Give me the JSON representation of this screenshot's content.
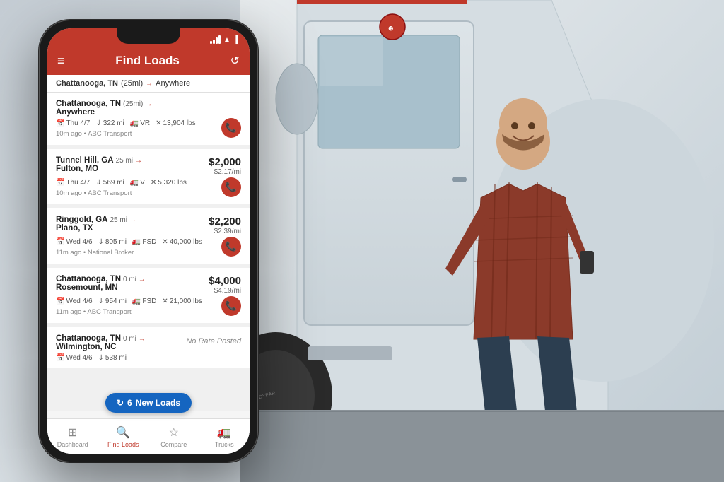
{
  "background": {
    "gradient_desc": "truck and person background scene"
  },
  "phone": {
    "header": {
      "title": "Find Loads",
      "menu_icon": "≡",
      "refresh_icon": "↺"
    },
    "route_bar": {
      "origin": "Chattanooga, TN",
      "origin_dist": "(25mi)",
      "arrow": "→",
      "destination": "Anywhere"
    },
    "loads": [
      {
        "id": 1,
        "origin": "Chattanooga, TN",
        "origin_dist": "(25mi)",
        "destination": "Anywhere",
        "price": "",
        "price_per_mile": "",
        "no_rate": true,
        "date": "Thu 4/7",
        "miles": "322 mi",
        "truck_type": "VR",
        "weight": "13,904 lbs",
        "time_ago": "10m ago",
        "broker": "ABC Transport"
      },
      {
        "id": 2,
        "origin": "Tunnel Hill, GA",
        "origin_dist": "25 mi",
        "destination": "Fulton, MO",
        "price": "$2,000",
        "price_per_mile": "$2.17/mi",
        "no_rate": false,
        "date": "Thu 4/7",
        "miles": "569 mi",
        "truck_type": "V",
        "weight": "5,320 lbs",
        "time_ago": "10m ago",
        "broker": "ABC Transport"
      },
      {
        "id": 3,
        "origin": "Ringgold, GA",
        "origin_dist": "25 mi",
        "destination": "Plano, TX",
        "price": "$2,200",
        "price_per_mile": "$2.39/mi",
        "no_rate": false,
        "date": "Wed 4/6",
        "miles": "805 mi",
        "truck_type": "FSD",
        "weight": "40,000 lbs",
        "time_ago": "11m ago",
        "broker": "National Broker"
      },
      {
        "id": 4,
        "origin": "Chattanooga, TN",
        "origin_dist": "0 mi",
        "destination": "Rosemount, MN",
        "price": "$4,000",
        "price_per_mile": "$4.19/mi",
        "no_rate": false,
        "date": "Wed 4/6",
        "miles": "954 mi",
        "truck_type": "FSD",
        "weight": "21,000 lbs",
        "time_ago": "11m ago",
        "broker": "ABC Transport"
      },
      {
        "id": 5,
        "origin": "Chattanooga, TN",
        "origin_dist": "0 mi",
        "destination": "Wilmington, NC",
        "price": "",
        "price_per_mile": "",
        "no_rate": true,
        "no_rate_text": "No Rate Posted",
        "date": "Wed 4/6",
        "miles": "538 mi",
        "truck_type": "",
        "weight": "",
        "time_ago": "",
        "broker": ""
      }
    ],
    "new_loads_btn": {
      "count": 6,
      "label": "New Loads",
      "icon": "↻"
    },
    "bottom_nav": [
      {
        "label": "Dashboard",
        "icon": "⊞",
        "active": false
      },
      {
        "label": "Find Loads",
        "icon": "🔍",
        "active": true
      },
      {
        "label": "Compare",
        "icon": "☆",
        "active": false
      },
      {
        "label": "Trucks",
        "icon": "🚛",
        "active": false
      }
    ]
  }
}
